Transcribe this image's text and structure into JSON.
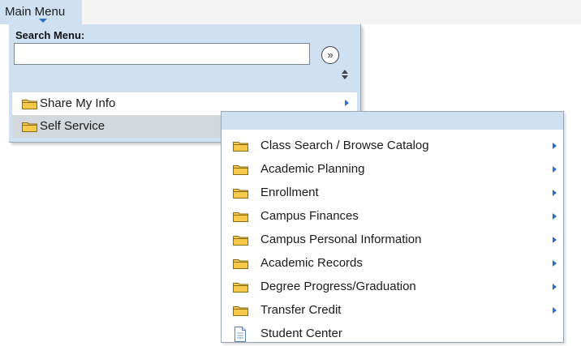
{
  "topbar": {
    "menu_label": "Main Menu"
  },
  "search": {
    "label": "Search Menu:",
    "value": "",
    "placeholder": "",
    "go_symbol": "»"
  },
  "menu": {
    "items": [
      {
        "label": "Share My Info",
        "icon": "folder-icon",
        "has_submenu": true
      },
      {
        "label": "Self Service",
        "icon": "folder-icon",
        "has_submenu": true,
        "active": true
      }
    ]
  },
  "submenu": {
    "items": [
      {
        "label": "Class Search / Browse Catalog",
        "icon": "folder-icon",
        "has_submenu": true
      },
      {
        "label": "Academic Planning",
        "icon": "folder-icon",
        "has_submenu": true
      },
      {
        "label": "Enrollment",
        "icon": "folder-icon",
        "has_submenu": true
      },
      {
        "label": "Campus Finances",
        "icon": "folder-icon",
        "has_submenu": true
      },
      {
        "label": "Campus Personal Information",
        "icon": "folder-icon",
        "has_submenu": true
      },
      {
        "label": "Academic Records",
        "icon": "folder-icon",
        "has_submenu": true
      },
      {
        "label": "Degree Progress/Graduation",
        "icon": "folder-icon",
        "has_submenu": true
      },
      {
        "label": "Transfer Credit",
        "icon": "folder-icon",
        "has_submenu": true
      },
      {
        "label": "Student Center",
        "icon": "document-icon",
        "has_submenu": false
      }
    ]
  },
  "colors": {
    "menu_bg": "#cfe0f0",
    "active_item_bg": "#d3d8dc",
    "accent_arrow": "#2a6fc4",
    "folder_fill": "#f6c94a"
  }
}
